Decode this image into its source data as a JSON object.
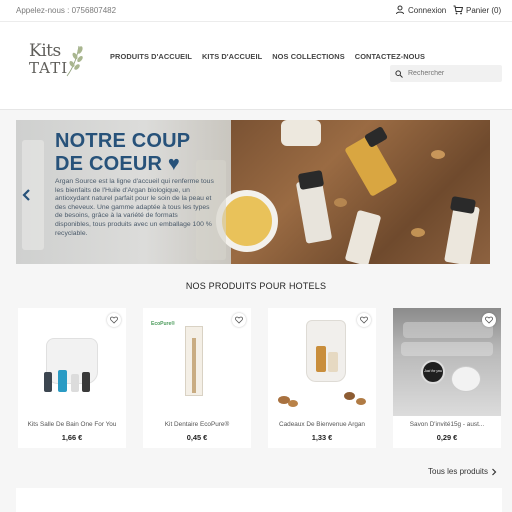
{
  "topbar": {
    "phone_text": "Appelez-nous : 0756807482",
    "login_label": "Connexion",
    "cart_label": "Panier (0)"
  },
  "logo": {
    "line1": "Kits",
    "line2": "TATI"
  },
  "nav": {
    "items": [
      "PRODUITS D'ACCUEIL",
      "KITS D'ACCUEIL",
      "NOS COLLECTIONS",
      "CONTACTEZ-NOUS"
    ]
  },
  "search": {
    "placeholder": "Rechercher"
  },
  "hero": {
    "title_line1": "NOTRE COUP",
    "title_line2": "DE COEUR ♥",
    "text": "Argan Source est la ligne d'accueil qui renferme tous les bienfaits de l'Huile d'Argan biologique, un antioxydant naturel parfait pour le soin de la peau et des cheveux. Une gamme adaptée à tous les types de besoins, grâce à la variété de formats disponibles, tous produits avec un emballage 100 % recyclable."
  },
  "section": {
    "title": "NOS PRODUITS POUR HOTELS"
  },
  "products": [
    {
      "name": "Kits Salle De Bain One For You",
      "price": "1,66 €",
      "image_label": ""
    },
    {
      "name": "Kit Dentaire EcoPure®",
      "price": "0,45 €",
      "image_label": "EcoPure®"
    },
    {
      "name": "Cadeaux De Bienvenue Argan",
      "price": "1,33 €",
      "image_label": ""
    },
    {
      "name": "Savon D'invité15g - aust...",
      "price": "0,29 €",
      "image_label": "Just for you"
    }
  ],
  "footer_link": {
    "label": "Tous les produits"
  },
  "colors": {
    "hero_title": "#27527a",
    "accent": "#24b9d7"
  }
}
